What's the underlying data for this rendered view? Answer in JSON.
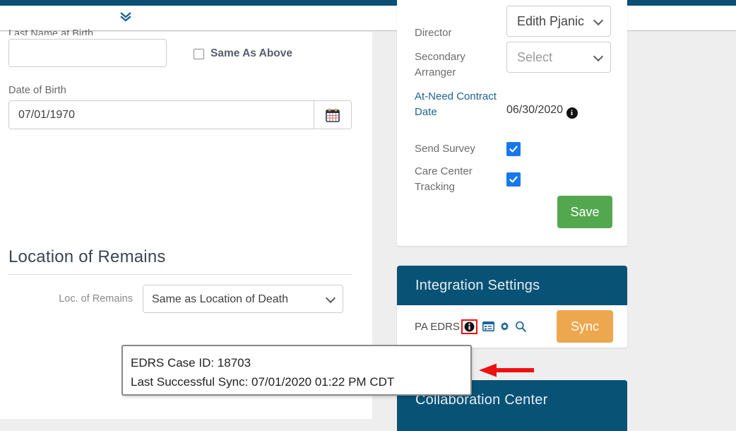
{
  "topbar": {
    "expand_icon": "chevron-double-down-icon"
  },
  "main_form": {
    "last_name_at_birth": {
      "label": "Last Name at Birth",
      "value": "",
      "placeholder": ""
    },
    "same_as_above": {
      "label": "Same As Above",
      "checked": false
    },
    "date_of_birth": {
      "label": "Date of Birth",
      "value": "07/01/1970",
      "calendar_icon": "calendar-icon"
    },
    "location_of_remains": {
      "heading": "Location of Remains",
      "field_label": "Loc. of Remains",
      "selected": "Same as Location of Death",
      "options": [
        "Same as Location of Death"
      ]
    }
  },
  "arrangement_panel": {
    "rows": [
      {
        "label": "Director",
        "type": "select",
        "value": "Edith Pjanic",
        "muted": false
      },
      {
        "label": "Secondary Arranger",
        "type": "select",
        "value": "Select",
        "muted": true
      },
      {
        "label": "At-Need Contract Date",
        "type": "value",
        "value": "06/30/2020",
        "is_link_label": true,
        "info_icon": "info-icon"
      },
      {
        "label": "Send Survey",
        "type": "checkbox",
        "checked": true
      },
      {
        "label": "Care Center Tracking",
        "type": "checkbox",
        "checked": true
      }
    ],
    "save_label": "Save"
  },
  "integration_panel": {
    "title": "Integration Settings",
    "edrs_name": "PA EDRS",
    "icons": [
      "info-icon",
      "window-list-icon",
      "gear-icon",
      "search-icon"
    ],
    "sync_label": "Sync"
  },
  "collaboration_panel": {
    "title": "Collaboration Center"
  },
  "tooltip": {
    "line1": "EDRS Case ID: 18703",
    "line2": "Last Successful Sync: 07/01/2020 01:22 PM CDT"
  },
  "annotations": {
    "highlight_box_color": "#ee1111",
    "arrow_color": "#ee1111",
    "arrow_icon": "arrow-left-icon"
  },
  "colors": {
    "header_bar": "#0a5075",
    "panel_header": "#085275",
    "save_green": "#53a84f",
    "sync_orange": "#eda74e",
    "checkbox_blue": "#1878ea",
    "link_blue": "#1a6496",
    "page_bg": "#eeeeee"
  }
}
